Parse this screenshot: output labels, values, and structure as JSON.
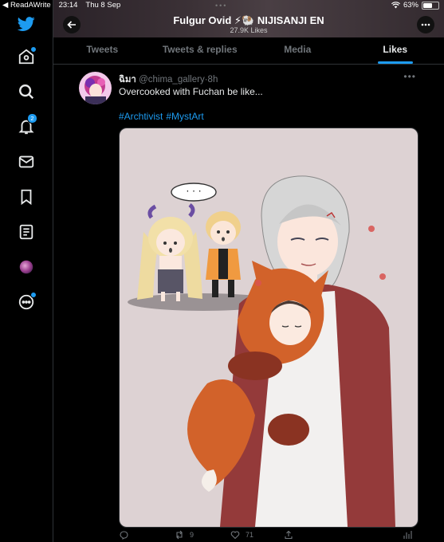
{
  "status_bar": {
    "back_app": "◀ ReadAWrite",
    "time": "23:14",
    "date": "Thu 8 Sep",
    "battery_text": "63%",
    "battery_level": 0.63
  },
  "sidebar": {
    "notifications_count": "2"
  },
  "header": {
    "title": "Fulgur Ovid ⚡🐏 NIJISANJI EN",
    "subtitle": "27.9K Likes"
  },
  "tabs": [
    {
      "label": "Tweets"
    },
    {
      "label": "Tweets & replies"
    },
    {
      "label": "Media"
    },
    {
      "label": "Likes",
      "active": true
    }
  ],
  "tweet": {
    "name": "ฉิมา",
    "handle": "@chima_gallery",
    "time": "8h",
    "text": "Overcooked with Fuchan be like...",
    "hashtags": [
      "#Archtivist",
      "#MystArt"
    ],
    "speech_bubble": "· · ·",
    "retweets": "9",
    "likes": "71"
  },
  "colors": {
    "accent": "#1d9bf0",
    "background": "#000000",
    "muted": "#71767b",
    "border": "#2f3336"
  }
}
